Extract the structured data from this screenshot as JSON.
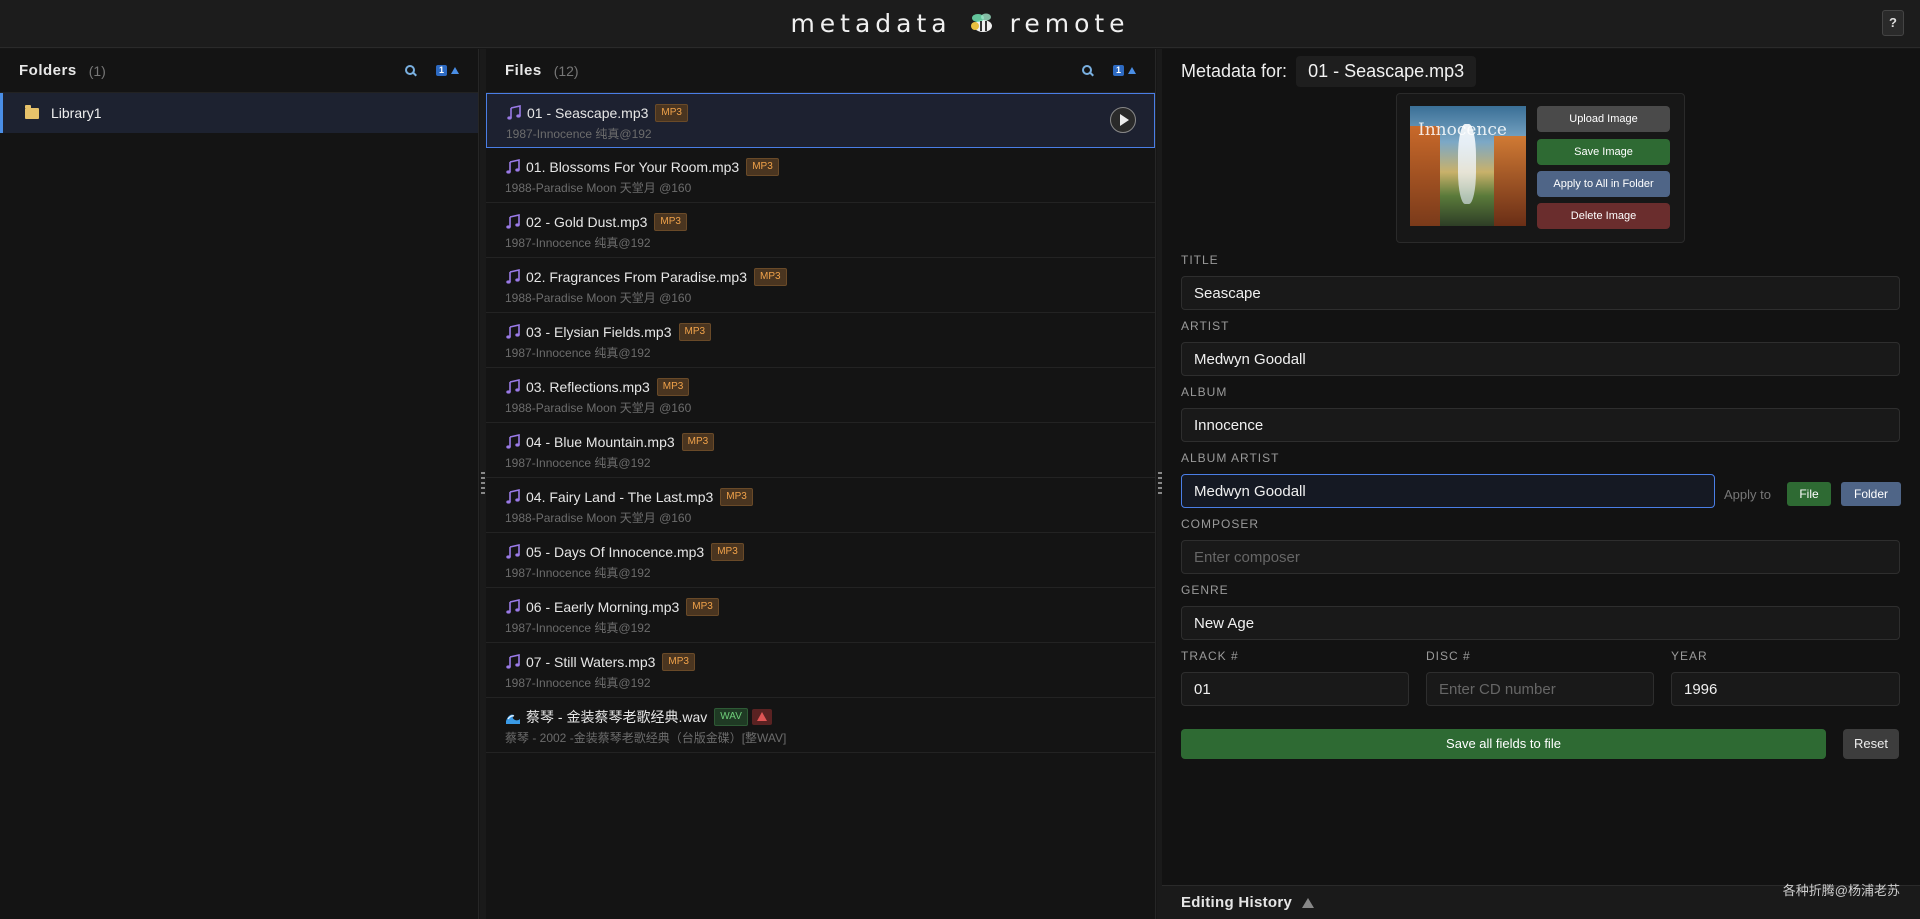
{
  "header": {
    "brand_left": "metadata",
    "brand_right": "remote",
    "help_label": "?"
  },
  "folders": {
    "title": "Folders",
    "count": "(1)",
    "sort_indicator": "1",
    "items": [
      {
        "label": "Library1",
        "icon": "folder-icon"
      }
    ]
  },
  "files": {
    "title": "Files",
    "count": "(12)",
    "sort_indicator": "1",
    "items": [
      {
        "name": "01 - Seascape.mp3",
        "badge": "MP3",
        "sub": "1987-Innocence 纯真@192",
        "type": "mp3",
        "selected": true
      },
      {
        "name": "01. Blossoms For Your Room.mp3",
        "badge": "MP3",
        "sub": "1988-Paradise Moon 天堂月 @160",
        "type": "mp3"
      },
      {
        "name": "02 - Gold Dust.mp3",
        "badge": "MP3",
        "sub": "1987-Innocence 纯真@192",
        "type": "mp3"
      },
      {
        "name": "02. Fragrances From Paradise.mp3",
        "badge": "MP3",
        "sub": "1988-Paradise Moon 天堂月 @160",
        "type": "mp3"
      },
      {
        "name": "03 - Elysian Fields.mp3",
        "badge": "MP3",
        "sub": "1987-Innocence 纯真@192",
        "type": "mp3"
      },
      {
        "name": "03. Reflections.mp3",
        "badge": "MP3",
        "sub": "1988-Paradise Moon 天堂月 @160",
        "type": "mp3"
      },
      {
        "name": "04 - Blue Mountain.mp3",
        "badge": "MP3",
        "sub": "1987-Innocence 纯真@192",
        "type": "mp3"
      },
      {
        "name": "04. Fairy Land - The Last.mp3",
        "badge": "MP3",
        "sub": "1988-Paradise Moon 天堂月 @160",
        "type": "mp3"
      },
      {
        "name": "05 - Days Of Innocence.mp3",
        "badge": "MP3",
        "sub": "1987-Innocence 纯真@192",
        "type": "mp3"
      },
      {
        "name": "06 - Eaerly Morning.mp3",
        "badge": "MP3",
        "sub": "1987-Innocence 纯真@192",
        "type": "mp3"
      },
      {
        "name": "07 - Still Waters.mp3",
        "badge": "MP3",
        "sub": "1987-Innocence 纯真@192",
        "type": "mp3"
      },
      {
        "name": "蔡琴 - 金装蔡琴老歌经典.wav",
        "badge": "WAV",
        "sub": "蔡琴 - 2002 -金装蔡琴老歌经典（台版金碟）[整WAV]",
        "type": "wav",
        "warning": true
      }
    ]
  },
  "meta": {
    "title": "Metadata for:",
    "file": "01 - Seascape.mp3",
    "art_text": "Innocence",
    "buttons": {
      "upload": "Upload Image",
      "save": "Save Image",
      "apply_all": "Apply to All in Folder",
      "delete": "Delete Image"
    },
    "fields": {
      "title": {
        "label": "TITLE",
        "value": "Seascape"
      },
      "artist": {
        "label": "ARTIST",
        "value": "Medwyn Goodall"
      },
      "album": {
        "label": "ALBUM",
        "value": "Innocence"
      },
      "album_artist": {
        "label": "ALBUM ARTIST",
        "value": "Medwyn Goodall"
      },
      "composer": {
        "label": "COMPOSER",
        "value": "",
        "placeholder": "Enter composer"
      },
      "genre": {
        "label": "GENRE",
        "value": "New Age"
      },
      "track": {
        "label": "TRACK #",
        "value": "01"
      },
      "disc": {
        "label": "DISC #",
        "value": "",
        "placeholder": "Enter CD number"
      },
      "year": {
        "label": "YEAR",
        "value": "1996"
      }
    },
    "apply_to": "Apply to",
    "apply_file": "File",
    "apply_folder": "Folder",
    "save_all": "Save all fields to file",
    "reset": "Reset",
    "history": "Editing History"
  },
  "watermark": "各种折腾@杨浦老苏",
  "colors": {
    "accent": "#4a7ee6",
    "mp3_badge": "#f0a24a",
    "wav_badge": "#6fcf7a",
    "save_green": "#2e6a33",
    "apply_blue": "#4f6587",
    "delete_red": "#6a2d2d"
  }
}
